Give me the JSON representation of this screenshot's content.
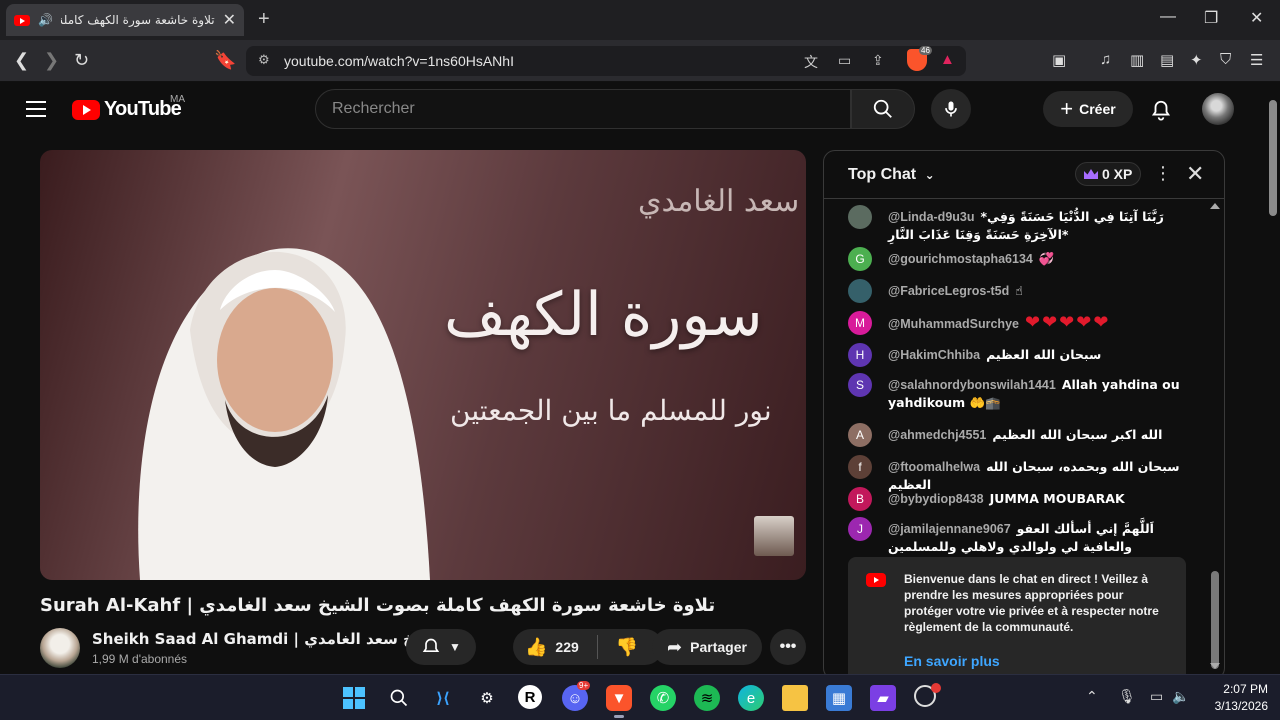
{
  "browser": {
    "tab_title": "تلاوة خاشعة سورة الكهف كاملة",
    "url": "youtube.com/watch?v=1ns60HsANhI",
    "brave_badge": "46"
  },
  "youtube": {
    "logo_text": "YouTube",
    "country_code": "MA",
    "search_placeholder": "Rechercher",
    "create_label": "Créer"
  },
  "video": {
    "calli_name": "سعد الغامدي",
    "calli_surah": "سورة الكهف",
    "calli_sub": "نور للمسلم ما بين الجمعتين",
    "title": "تلاوة خاشعة سورة الكهف كاملة بصوت الشيخ سعد الغامدي | Surah Al-Kahf",
    "channel_name": "Sheikh Saad Al Ghamdi | الشيخ سعد الغامدي",
    "subscribers": "1,99 M d'abonnés",
    "likes": "229",
    "share_label": "Partager"
  },
  "chat": {
    "header": "Top Chat",
    "xp": "0 XP",
    "messages": [
      {
        "author": "@Linda-d9u3u",
        "text": "*رَبَّنَا آتِنَا فِي الدُّنْيَا حَسَنَةً وَفِي الآخِرَةِ حَسَنَةً وَقِنَا عَذَابَ النَّارِ*",
        "avatar": "",
        "color": "#5b6b60"
      },
      {
        "author": "@gourichmostapha6134",
        "text": "💞",
        "avatar": "G",
        "color": "#4caf50"
      },
      {
        "author": "@FabriceLegros-t5d",
        "text": "☝",
        "avatar": "",
        "color": "#35606a"
      },
      {
        "author": "@MuhammadSurchye",
        "text": "❤❤❤❤❤",
        "avatar": "M",
        "color": "#d81b9a"
      },
      {
        "author": "@HakimChhiba",
        "text": "سبحان الله العظيم",
        "avatar": "H",
        "color": "#5e35b1"
      },
      {
        "author": "@salahnordybonswilah1441",
        "text": "Allah yahdina ou yahdikoum 🤲🕋",
        "avatar": "S",
        "color": "#5e35b1"
      },
      {
        "author": "@ahmedchj4551",
        "text": "الله اكبر سبحان الله العظيم",
        "avatar": "A",
        "color": "#8d6e63"
      },
      {
        "author": "@ftoomalhelwa",
        "text": "سبحان الله وبحمده، سبحان الله العظيم",
        "avatar": "f",
        "color": "#5d4037"
      },
      {
        "author": "@bybydiop8438",
        "text": "JUMMA MOUBARAK",
        "avatar": "B",
        "color": "#c2185b"
      },
      {
        "author": "@jamilajennane9067",
        "text": "اَللَّهمَّ إني أسألك العفو والعافية لي ولوالدي ولاهلي وللمسلمين والمسلمات",
        "avatar": "J",
        "color": "#9c27b0"
      }
    ],
    "banner_text": "Bienvenue dans le chat en direct ! Veillez à prendre les mesures appropriées pour protéger votre vie privée et à respecter notre règlement de la communauté.",
    "banner_link": "En savoir plus"
  },
  "taskbar": {
    "time": "2:07 PM",
    "date": "3/13/2026",
    "discord_badge": "9+"
  }
}
